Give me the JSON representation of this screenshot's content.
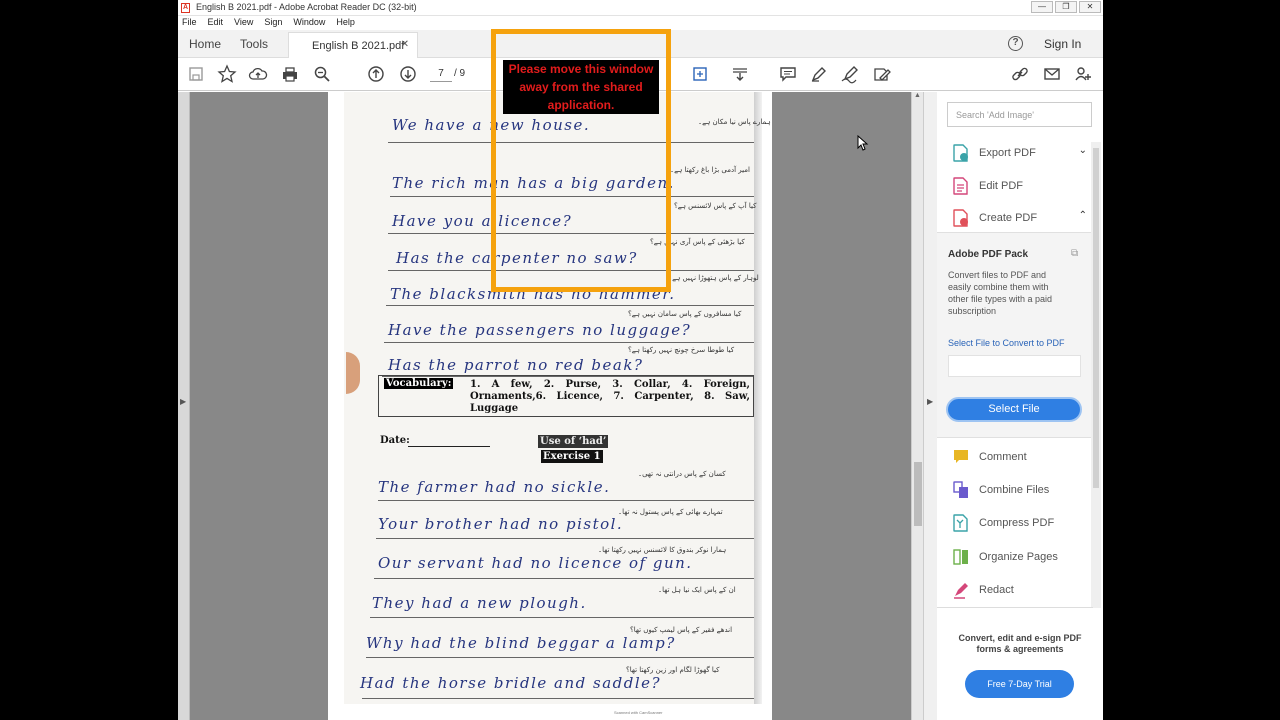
{
  "window": {
    "title": "English B 2021.pdf - Adobe Acrobat Reader DC (32-bit)",
    "app_icon_glyph": "A",
    "controls": [
      "—",
      "❐",
      "✕"
    ]
  },
  "menu": [
    "File",
    "Edit",
    "View",
    "Sign",
    "Window",
    "Help"
  ],
  "tabs": {
    "home": "Home",
    "tools": "Tools",
    "document": "English B 2021.pdf",
    "close": "✕",
    "help": "?",
    "signin": "Sign In"
  },
  "toolbar": {
    "current_page": "7",
    "total_pages": "/ 9"
  },
  "share_warning": "Please move this window away from the shared application.",
  "document_page": {
    "sentences_1": [
      "We have a new house.",
      "The rich man has a big garden.",
      "Have you a licence?",
      "Has the carpenter no saw?",
      "The blacksmith has no hammer.",
      "Have the passengers no luggage?",
      "Has the parrot no red beak?"
    ],
    "urdu_1": [
      "ہمارے پاس نیا مکان ہے۔",
      "امیر آدمی بڑا باغ رکھتا ہے۔",
      "کیا آپ کے پاس لائسنس ہے؟",
      "کیا بڑھئی کے پاس آری نہیں ہے؟",
      "لوہار کے پاس ہتھوڑا نہیں ہے۔",
      "کیا مسافروں کے پاس سامان نہیں ہے؟",
      "کیا طوطا سرخ چونچ نہیں رکھتا ہے؟"
    ],
    "vocabulary_label": "Vocabulary:",
    "vocabulary_text": "1. A few, 2. Purse, 3. Collar, 4. Foreign, Ornaments,6. Licence, 7. Carpenter, 8. Saw, Luggage",
    "date_label": "Date:",
    "use_of": "Use of ‘had’",
    "exercise": "Exercise 1",
    "sentences_2": [
      "The farmer had no sickle.",
      "Your brother had no pistol.",
      "Our servant had no licence of gun.",
      "They had a new plough.",
      "Why had the blind beggar a lamp?",
      "Had the horse bridle and saddle?"
    ],
    "urdu_2": [
      "کسان کے پاس درانتی نہ تھی۔",
      "تمہارے بھائی کے پاس پستول نہ تھا۔",
      "ہمارا نوکر بندوق کا لائسنس نہیں رکھتا تھا۔",
      "ان کے پاس ایک نیا ہل تھا۔",
      "اندھے فقیر کے پاس لیمپ کیوں تھا؟",
      "کیا گھوڑا لگام اور زین رکھتا تھا؟"
    ],
    "footer": "Scanned with CamScanner"
  },
  "right_pane": {
    "search_placeholder": "Search 'Add Image'",
    "tools_top": [
      {
        "label": "Export PDF",
        "chevron": "⌄",
        "color": "#3aa3a8"
      },
      {
        "label": "Edit PDF",
        "chevron": "",
        "color": "#d4477a"
      },
      {
        "label": "Create PDF",
        "chevron": "⌃",
        "color": "#e0505a"
      }
    ],
    "pack": {
      "title": "Adobe PDF Pack",
      "description": "Convert files to PDF and easily combine them with other file types with a paid subscription",
      "select_link": "Select File to Convert to PDF",
      "button": "Select File"
    },
    "tools_bottom": [
      {
        "label": "Comment",
        "color": "#e8b624"
      },
      {
        "label": "Combine Files",
        "color": "#6a5acd"
      },
      {
        "label": "Compress PDF",
        "color": "#3aa3a8"
      },
      {
        "label": "Organize Pages",
        "color": "#6db04a"
      },
      {
        "label": "Redact",
        "color": "#d4477a"
      }
    ],
    "promo": "Convert, edit and e-sign PDF forms & agreements",
    "trial_button": "Free 7-Day Trial"
  }
}
